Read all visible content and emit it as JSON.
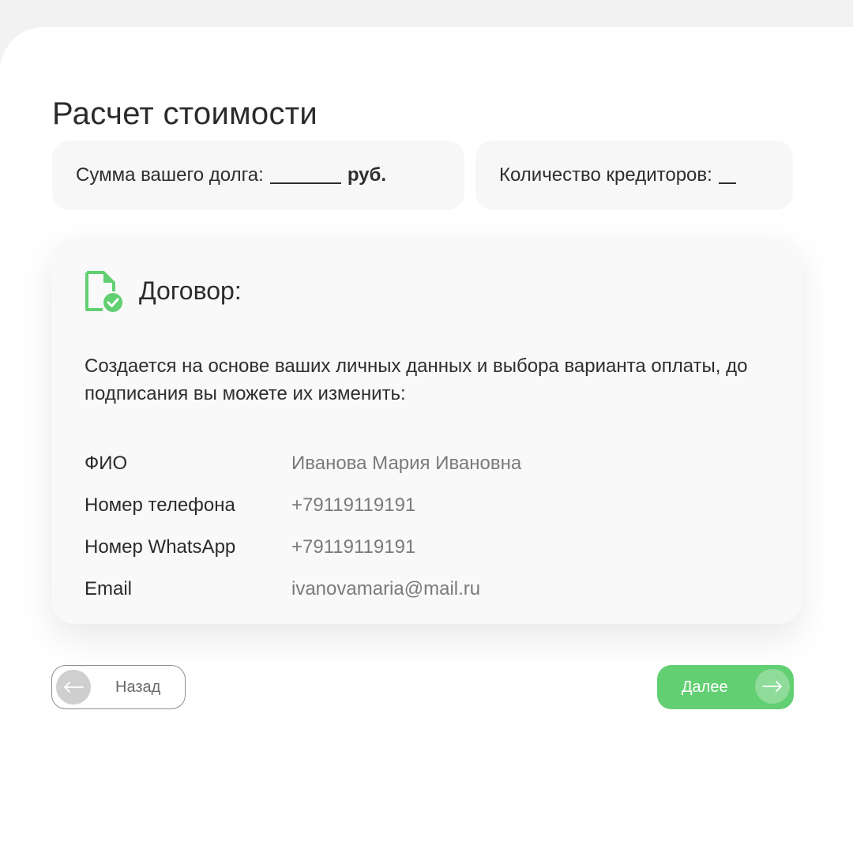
{
  "page": {
    "title": "Расчет стоимости"
  },
  "debt": {
    "label": "Сумма вашего долга:",
    "value": "",
    "unit": "руб."
  },
  "creditors": {
    "label": "Количество кредиторов:",
    "value": ""
  },
  "contract": {
    "icon": "document-check-icon",
    "title": "Договор:",
    "description": "Создается на основе ваших личных данных и выбора варианта оплаты, до подписания вы можете их изменить:",
    "fields": [
      {
        "label": "ФИО",
        "value": "Иванова Мария Ивановна"
      },
      {
        "label": "Номер телефона",
        "value": "+79119119191"
      },
      {
        "label": "Номер WhatsApp",
        "value": "+79119119191"
      },
      {
        "label": "Email",
        "value": "ivanovamaria@mail.ru"
      }
    ]
  },
  "nav": {
    "back_label": "Назад",
    "back_icon": "arrow-left-icon",
    "next_label": "Далее",
    "next_icon": "arrow-right-icon"
  },
  "colors": {
    "accent": "#62cf72",
    "accent_light": "#8fdc9a",
    "text": "#2e2e2e",
    "muted": "#7a7a7a",
    "background": "#f2f2f2",
    "card": "#f9f9f9"
  }
}
